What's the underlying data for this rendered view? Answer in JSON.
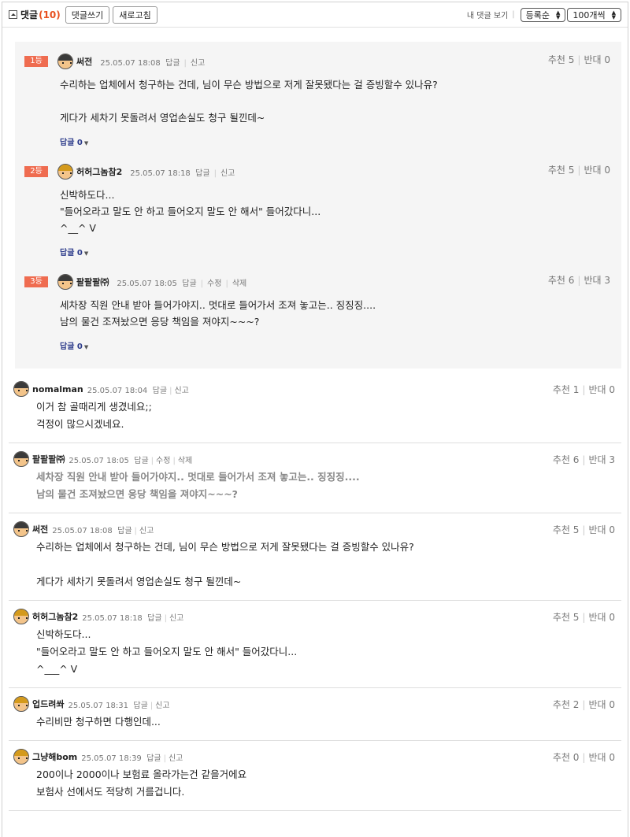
{
  "header": {
    "title": "댓글",
    "count": "(10)",
    "write_button": "댓글쓰기",
    "refresh_button": "새로고침",
    "my_comments": "내 댓글 보기",
    "sort_select": "등록순",
    "page_size_select": "100개씩"
  },
  "best": [
    {
      "rank": "1등",
      "nick": "써전",
      "date": "25.05.07 18:08",
      "actions": [
        "답글",
        "신고"
      ],
      "up": "추천 5",
      "down": "반대 0",
      "lines": [
        "수리하는 업체에서 청구하는 건데, 님이 무슨 방법으로 저게 잘못됐다는 걸 증빙할수 있나유?",
        "",
        "게다가 세차기 못돌려서 영업손실도 청구 될낀데~"
      ],
      "reply": "답글 0"
    },
    {
      "rank": "2등",
      "nick": "허허그놈참2",
      "date": "25.05.07 18:18",
      "actions": [
        "답글",
        "신고"
      ],
      "up": "추천 5",
      "down": "반대 0",
      "lines": [
        "신박하도다...",
        "\"들어오라고 말도 안 하고 들어오지 말도 안 해서\" 들어갔다니...",
        "^__^ V"
      ],
      "reply": "답글 0"
    },
    {
      "rank": "3등",
      "nick": "팔팔팔㈜",
      "date": "25.05.07 18:05",
      "actions": [
        "답글",
        "수정",
        "삭제"
      ],
      "up": "추천 6",
      "down": "반대 3",
      "lines": [
        "세차장 직원 안내 받아 들어가야지.. 멋대로 들어가서 조져 놓고는.. 징징징....",
        "남의 물건 조져놨으면 응당 책임을 져야지~~~?"
      ],
      "reply": "답글 0"
    }
  ],
  "comments": [
    {
      "nick": "nomalman",
      "date": "25.05.07 18:04",
      "actions": [
        "답글",
        "신고"
      ],
      "up": "추천 1",
      "down": "반대 0",
      "lines": [
        "이거 참 골때리게 생겼네요;;",
        "걱정이 많으시겠네요."
      ],
      "gray": false
    },
    {
      "nick": "팔팔팔㈜",
      "date": "25.05.07 18:05",
      "actions": [
        "답글",
        "수정",
        "삭제"
      ],
      "up": "추천 6",
      "down": "반대 3",
      "lines": [
        "세차장 직원 안내 받아 들어가야지.. 멋대로 들어가서 조져 놓고는.. 징징징....",
        "남의 물건 조져놨으면 응당 책임을 져야지~~~?"
      ],
      "gray": true
    },
    {
      "nick": "써전",
      "date": "25.05.07 18:08",
      "actions": [
        "답글",
        "신고"
      ],
      "up": "추천 5",
      "down": "반대 0",
      "lines": [
        "수리하는 업체에서 청구하는 건데, 님이 무슨 방법으로 저게 잘못됐다는 걸 증빙할수 있나유?",
        "",
        "게다가 세차기 못돌려서 영업손실도 청구 될낀데~"
      ],
      "gray": false
    },
    {
      "nick": "허허그놈참2",
      "date": "25.05.07 18:18",
      "actions": [
        "답글",
        "신고"
      ],
      "up": "추천 5",
      "down": "반대 0",
      "lines": [
        "신박하도다...",
        "\"들어오라고 말도 안 하고 들어오지 말도 안 해서\" 들어갔다니...",
        "^___^ V"
      ],
      "gray": false
    },
    {
      "nick": "업드려쏴",
      "date": "25.05.07 18:31",
      "actions": [
        "답글",
        "신고"
      ],
      "up": "추천 2",
      "down": "반대 0",
      "lines": [
        "수리비만 청구하면 다행인데..."
      ],
      "gray": false
    },
    {
      "nick": "그냥해bom",
      "date": "25.05.07 18:39",
      "actions": [
        "답글",
        "신고"
      ],
      "up": "추천 0",
      "down": "반대 0",
      "lines": [
        "200이나 2000이나 보험료 올라가는건 같을거에요",
        "보험사 선에서도 적당히 거를겁니다."
      ],
      "gray": false
    }
  ],
  "colors": {
    "rank_badge": "#ef6c50",
    "count": "#e8501f",
    "reply_link": "#2b3a8a",
    "best_bg": "#f5f5f5"
  }
}
